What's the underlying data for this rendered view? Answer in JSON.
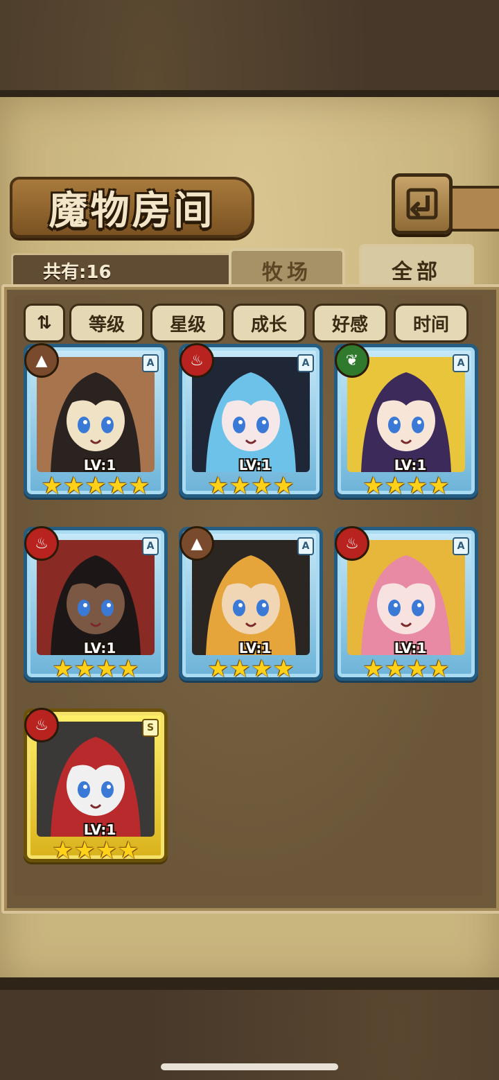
{
  "header": {
    "title": "魔物房间",
    "return_icon": "return-arrow-icon"
  },
  "summary": {
    "count_label": "共有:16"
  },
  "tabs": [
    {
      "label": "牧场",
      "selected": false
    },
    {
      "label": "全部",
      "selected": true
    }
  ],
  "filters": {
    "toggle_label": "⇅",
    "items": [
      {
        "label": "等级"
      },
      {
        "label": "星级"
      },
      {
        "label": "成长"
      },
      {
        "label": "好感"
      },
      {
        "label": "时间"
      }
    ]
  },
  "monsters": [
    {
      "element": "earth",
      "rank": "A",
      "level": "LV:1",
      "stars": 5,
      "frame": "blue",
      "palette": [
        "#2a2320",
        "#a8744e",
        "#efe2c5"
      ]
    },
    {
      "element": "fire",
      "rank": "A",
      "level": "LV:1",
      "stars": 4,
      "frame": "blue",
      "palette": [
        "#6dc2ea",
        "#1f2635",
        "#f6e7e8"
      ]
    },
    {
      "element": "wood",
      "rank": "A",
      "level": "LV:1",
      "stars": 4,
      "frame": "blue",
      "palette": [
        "#3c2a5a",
        "#e8c53a",
        "#f7e6d8"
      ]
    },
    {
      "element": "fire",
      "rank": "A",
      "level": "LV:1",
      "stars": 4,
      "frame": "blue",
      "palette": [
        "#1c1716",
        "#8a2a24",
        "#7b5843"
      ]
    },
    {
      "element": "earth",
      "rank": "A",
      "level": "LV:1",
      "stars": 4,
      "frame": "blue",
      "palette": [
        "#e5a53a",
        "#2c2622",
        "#f1d6b6"
      ]
    },
    {
      "element": "fire",
      "rank": "A",
      "level": "LV:1",
      "stars": 4,
      "frame": "blue",
      "palette": [
        "#e98aa4",
        "#e7b73c",
        "#f8e2df"
      ]
    },
    {
      "element": "fire",
      "rank": "S",
      "level": "LV:1",
      "stars": 4,
      "frame": "gold",
      "palette": [
        "#b82a2c",
        "#3b3838",
        "#f1f0f0"
      ]
    }
  ],
  "colors": {
    "frame_blue": "#245c82",
    "frame_gold": "#6b5208",
    "fire": "#b8231f",
    "earth": "#7a4a2c",
    "wood": "#2f7a2c"
  }
}
